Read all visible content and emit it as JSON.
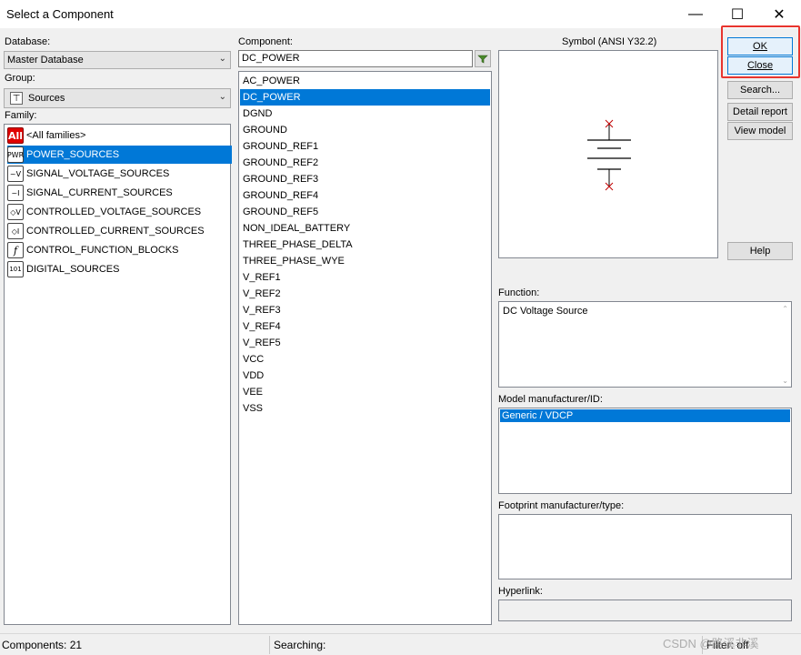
{
  "window": {
    "title": "Select a Component",
    "minimize_glyph": "—",
    "maximize_glyph": "☐",
    "close_glyph": "✕"
  },
  "database": {
    "label": "Database:",
    "value": "Master Database"
  },
  "group": {
    "label": "Group:",
    "value": "Sources",
    "icon": "ground-sources-icon"
  },
  "family": {
    "label": "Family:",
    "items": [
      {
        "label": "<All families>",
        "icon": "All"
      },
      {
        "label": "POWER_SOURCES",
        "icon": "PWR"
      },
      {
        "label": "SIGNAL_VOLTAGE_SOURCES",
        "icon": "~V"
      },
      {
        "label": "SIGNAL_CURRENT_SOURCES",
        "icon": "~I"
      },
      {
        "label": "CONTROLLED_VOLTAGE_SOURCES",
        "icon": "◇V"
      },
      {
        "label": "CONTROLLED_CURRENT_SOURCES",
        "icon": "◇I"
      },
      {
        "label": "CONTROL_FUNCTION_BLOCKS",
        "icon": "f"
      },
      {
        "label": "DIGITAL_SOURCES",
        "icon": "101"
      }
    ],
    "selected_index": 1
  },
  "component": {
    "label": "Component:",
    "value": "DC_POWER",
    "items": [
      "AC_POWER",
      "DC_POWER",
      "DGND",
      "GROUND",
      "GROUND_REF1",
      "GROUND_REF2",
      "GROUND_REF3",
      "GROUND_REF4",
      "GROUND_REF5",
      "NON_IDEAL_BATTERY",
      "THREE_PHASE_DELTA",
      "THREE_PHASE_WYE",
      "V_REF1",
      "V_REF2",
      "V_REF3",
      "V_REF4",
      "V_REF5",
      "VCC",
      "VDD",
      "VEE",
      "VSS"
    ],
    "selected_index": 1
  },
  "symbol": {
    "label": "Symbol (ANSI Y32.2)"
  },
  "buttons": {
    "ok": "OK",
    "close": "Close",
    "search": "Search...",
    "detail_report": "Detail report",
    "view_model": "View model",
    "help": "Help"
  },
  "function": {
    "label": "Function:",
    "value": "DC Voltage Source"
  },
  "model": {
    "label": "Model manufacturer/ID:",
    "items": [
      "Generic / VDCP"
    ]
  },
  "footprint": {
    "label": "Footprint manufacturer/type:"
  },
  "hyperlink": {
    "label": "Hyperlink:"
  },
  "status": {
    "components": "Components: 21",
    "searching": "Searching:",
    "filter": "Filter: off"
  },
  "watermark": "CSDN @路溪非溪",
  "colors": {
    "selection": "#0078d7",
    "highlight_frame": "#e8352e",
    "symbol_terminal": "#c00000"
  }
}
